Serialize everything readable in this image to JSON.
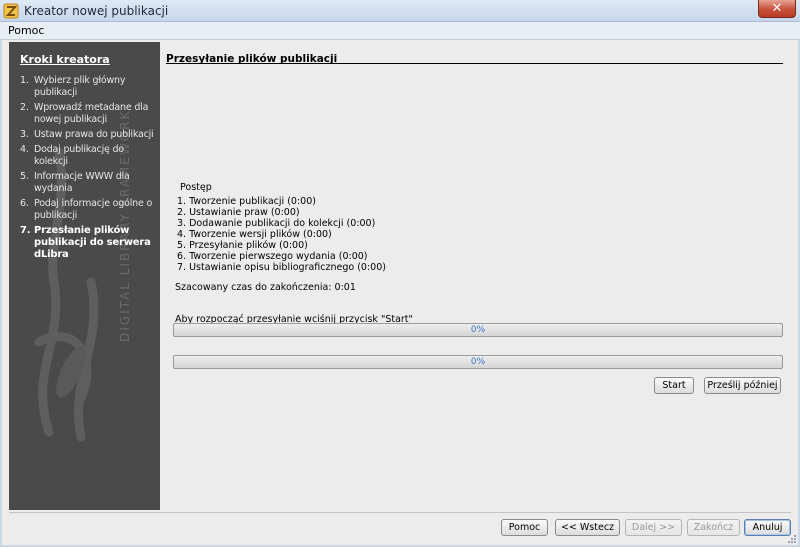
{
  "window": {
    "title": "Kreator nowej publikacji",
    "close_symbol": "✕",
    "app_icon": "dlibra-logo-icon"
  },
  "menu": {
    "items": [
      {
        "label": "Pomoc"
      }
    ]
  },
  "sidebar": {
    "heading": "Kroki kreatora",
    "steps": [
      {
        "num": "1.",
        "label": "Wybierz plik główny publikacji"
      },
      {
        "num": "2.",
        "label": "Wprowadź metadane dla nowej publikacji"
      },
      {
        "num": "3.",
        "label": "Ustaw prawa do publikacji"
      },
      {
        "num": "4.",
        "label": "Dodaj publikację do kolekcji"
      },
      {
        "num": "5.",
        "label": "Informacje WWW dla wydania"
      },
      {
        "num": "6.",
        "label": "Podaj informacje ogólne o publikacji"
      },
      {
        "num": "7.",
        "label": "Przesłanie plików publikacji do serwera dLibra",
        "active": true
      }
    ],
    "watermark": "DIGITAL LIBRARY FRAMEWORK"
  },
  "main": {
    "section_title": "Przesyłanie plików publikacji",
    "progress": {
      "heading": "Postęp",
      "items": [
        "1. Tworzenie publikacji (0:00)",
        "2. Ustawianie praw (0:00)",
        "3. Dodawanie publikacji do kolekcji (0:00)",
        "4. Tworzenie wersji plików (0:00)",
        "5. Przesyłanie plików (0:00)",
        "6. Tworzenie pierwszego wydania (0:00)",
        "7. Ustawianie opisu bibliograficznego (0:00)"
      ]
    },
    "eta_label": "Szacowany czas do zakończenia: 0:01",
    "start_hint": "Aby rozpocząć przesyłanie wciśnij przycisk \"Start\"",
    "progress_bars": [
      {
        "text": "0%",
        "value": 0
      },
      {
        "text": "0%",
        "value": 0
      }
    ],
    "start_button": "Start",
    "later_button": "Prześlij później"
  },
  "footer": {
    "help_button": "Pomoc",
    "back_button": "<< Wstecz",
    "next_button": "Dalej >>",
    "finish_button": "Zakończ",
    "cancel_button": "Anuluj"
  },
  "colors": {
    "sidebar_bg": "#4a4a4a",
    "progress_text": "#3a75c4",
    "close_button": "#c7503a"
  }
}
